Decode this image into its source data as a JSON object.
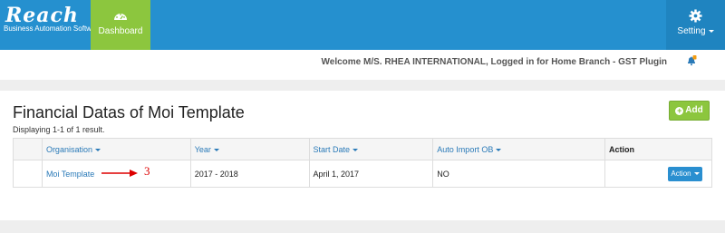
{
  "brand": {
    "name": "Reach",
    "tagline": "Business Automation Software"
  },
  "nav": {
    "dashboard_label": "Dashboard",
    "setting_label": "Setting"
  },
  "welcome": {
    "text": "Welcome M/S. RHEA INTERNATIONAL, Logged in for Home Branch - GST Plugin"
  },
  "page": {
    "title": "Financial Datas of Moi Template",
    "result_count": "Displaying 1-1 of 1 result.",
    "add_label": "Add"
  },
  "table": {
    "headers": {
      "organisation": "Organisation",
      "year": "Year",
      "start_date": "Start Date",
      "auto_import": "Auto Import OB",
      "action": "Action"
    },
    "rows": [
      {
        "organisation": "Moi Template",
        "year": "2017 - 2018",
        "start_date": "April 1, 2017",
        "auto_import": "NO",
        "action_label": "Action"
      }
    ]
  },
  "annotation": {
    "number": "3"
  },
  "colors": {
    "topbar": "#2590cf",
    "dashboard": "#8cc63e",
    "link": "#2a7ab8",
    "annotation": "#dd0000"
  }
}
